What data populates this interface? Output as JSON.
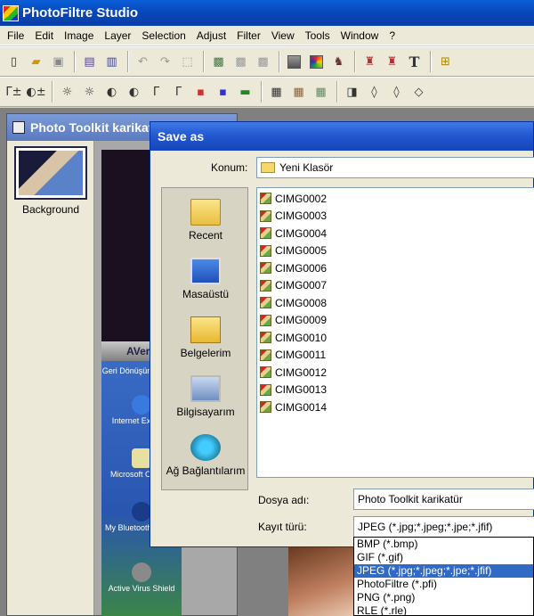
{
  "app": {
    "title": "PhotoFiltre Studio",
    "menu": [
      "File",
      "Edit",
      "Image",
      "Layer",
      "Selection",
      "Adjust",
      "Filter",
      "View",
      "Tools",
      "Window",
      "?"
    ]
  },
  "image_window": {
    "title": "Photo Toolkit karikatür",
    "layer_label": "Background",
    "desktop_logo": "AVer",
    "desktop_icons": [
      "Geri Dönüşüm Kutusu",
      "Internet Explorer",
      "Microsoft Outlook",
      "My Bluetooth Places",
      "Active Virus Shield"
    ]
  },
  "dialog": {
    "title": "Save as",
    "location_label": "Konum:",
    "location_value": "Yeni Klasör",
    "places": [
      "Recent",
      "Masaüstü",
      "Belgelerim",
      "Bilgisayarım",
      "Ağ Bağlantılarım"
    ],
    "files": [
      "CIMG0002",
      "CIMG0003",
      "CIMG0004",
      "CIMG0005",
      "CIMG0006",
      "CIMG0007",
      "CIMG0008",
      "CIMG0009",
      "CIMG0010",
      "CIMG0011",
      "CIMG0012",
      "CIMG0013",
      "CIMG0014"
    ],
    "filename_label": "Dosya adı:",
    "filename_value": "Photo Toolkit karikatür",
    "filetype_label": "Kayıt türü:",
    "filetype_value": "JPEG (*.jpg;*.jpeg;*.jpe;*.jfif)",
    "filetype_options": [
      "BMP (*.bmp)",
      "GIF (*.gif)",
      "JPEG (*.jpg;*.jpeg;*.jpe;*.jfif)",
      "PhotoFiltre (*.pfi)",
      "PNG (*.png)",
      "RLE (*.rle)"
    ],
    "filetype_selected_index": 2
  }
}
